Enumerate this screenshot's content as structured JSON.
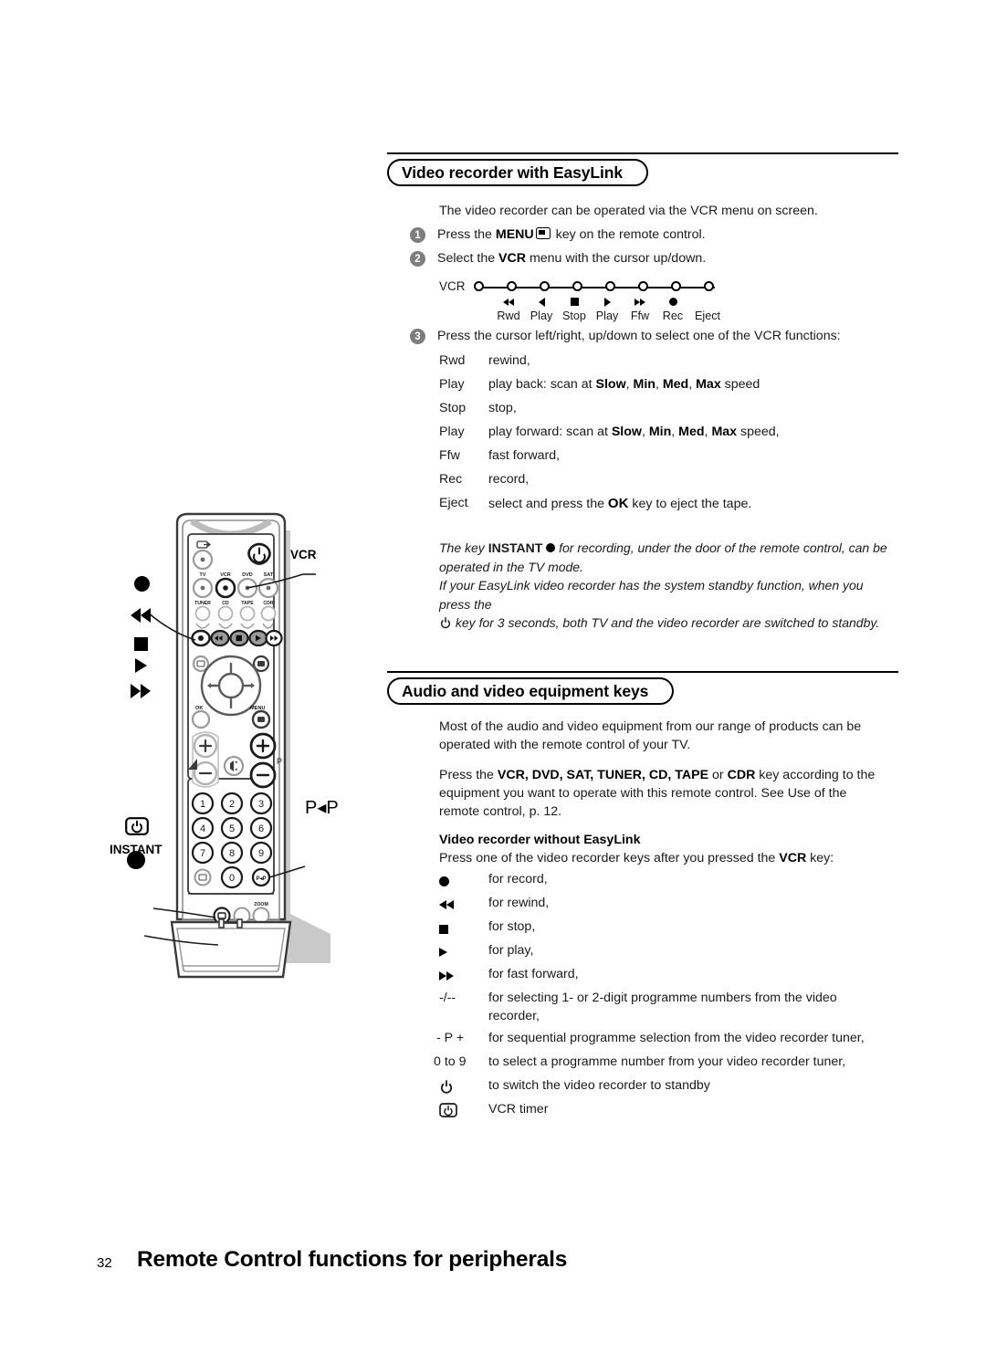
{
  "page": {
    "number": "32",
    "footer_title": "Remote Control functions for peripherals"
  },
  "section1": {
    "heading": "Video recorder with EasyLink",
    "intro": "The video recorder can be operated via the VCR menu on screen.",
    "steps": [
      {
        "num": "1",
        "before": "Press  the ",
        "bold": "MENU",
        "icon": "menu-key-icon",
        "after": " key on the remote control."
      },
      {
        "num": "2",
        "before": "Select the ",
        "bold": "VCR",
        "after": " menu with the cursor up/down."
      },
      {
        "num": "3",
        "before": "Press the cursor left/right, up/down to select one of the VCR functions:"
      }
    ],
    "vcr_diagram": {
      "label": "VCR",
      "nodes": [
        {
          "caption": "",
          "icon": ""
        },
        {
          "caption": "Rwd",
          "icon": "rewind-icon"
        },
        {
          "caption": "Play",
          "icon": "play-back-icon"
        },
        {
          "caption": "Stop",
          "icon": "stop-icon"
        },
        {
          "caption": "Play",
          "icon": "play-icon"
        },
        {
          "caption": "Ffw",
          "icon": "fast-forward-icon"
        },
        {
          "caption": "Rec",
          "icon": "record-icon"
        },
        {
          "caption": "Eject",
          "icon": ""
        }
      ]
    },
    "functions": [
      {
        "term": "Rwd",
        "desc_plain": "rewind,"
      },
      {
        "term": "Play",
        "desc_pre": "play back: scan at ",
        "b1": "Slow",
        "s1": ", ",
        "b2": "Min",
        "s2": ", ",
        "b3": "Med",
        "s3": ", ",
        "b4": "Max",
        "desc_post": " speed"
      },
      {
        "term": "Stop",
        "desc_plain": "stop,"
      },
      {
        "term": "Play",
        "desc_pre": "play forward: scan at ",
        "b1": "Slow",
        "s1": ", ",
        "b2": "Min",
        "s2": ", ",
        "b3": "Med",
        "s3": ", ",
        "b4": "Max",
        "desc_post": " speed,"
      },
      {
        "term": "Ffw",
        "desc_plain": "fast forward,"
      },
      {
        "term": "Rec",
        "desc_plain": "record,"
      },
      {
        "term": "Eject",
        "desc_pre": "select and press the ",
        "b1": "OK",
        "desc_post": " key to eject the tape."
      }
    ],
    "note": {
      "line1_a": "The key ",
      "line1_bold": "INSTANT",
      "line1_icon": "record-dot-icon",
      "line1_b": " for recording, under the door of the remote control, can be",
      "line2": "operated in the TV mode.",
      "line3": "If your EasyLink video recorder has the system standby function, when you press the",
      "line4_icon": "power-standby-icon",
      "line4": " key for 3 seconds, both TV and the video recorder are switched to standby."
    }
  },
  "section2": {
    "heading": "Audio and video equipment keys",
    "para1_line1": "Most of the audio and video equipment from our range of products can be",
    "para1_line2": "operated with the remote control of your TV.",
    "para2_pre": "Press the ",
    "para2_keys": "VCR, DVD, SAT, TUNER, CD, TAPE",
    "para2_mid": " or ",
    "para2_key2": "CDR",
    "para2_post": " key according to the",
    "para2_line2": "equipment you want to operate with this remote control. See Use of the",
    "para2_line3": "remote control, p. 12.",
    "subheading": "Video recorder without EasyLink",
    "sub_intro_pre": "Press one of the video recorder keys after you pressed the ",
    "sub_intro_bold": "VCR",
    "sub_intro_post": " key:",
    "keys": [
      {
        "icon": "record-icon",
        "term": "",
        "desc": "for record,"
      },
      {
        "icon": "rewind-icon",
        "term": "",
        "desc": "for rewind,"
      },
      {
        "icon": "stop-icon",
        "term": "",
        "desc": "for stop,"
      },
      {
        "icon": "play-icon",
        "term": "",
        "desc": "for play,"
      },
      {
        "icon": "fast-forward-icon",
        "term": "",
        "desc": "for fast forward,"
      },
      {
        "icon": "",
        "term": "-/--",
        "desc": "for selecting 1- or 2-digit programme numbers from the video",
        "desc2": "recorder,"
      },
      {
        "icon": "",
        "term": "- P +",
        "desc": "for sequential programme selection from the video recorder tuner,"
      },
      {
        "icon": "",
        "term": "0 to 9",
        "desc": "to select a programme number from your video recorder tuner,"
      },
      {
        "icon": "power-standby-icon",
        "term": "",
        "desc": "to switch the video recorder to standby"
      },
      {
        "icon": "vcr-timer-icon",
        "term": "",
        "desc": "VCR timer"
      }
    ]
  },
  "remote_figure": {
    "callouts": [
      {
        "id": "vcr",
        "label": "VCR"
      },
      {
        "id": "pip",
        "label": "P◂P"
      },
      {
        "id": "instant",
        "label": "INSTANT"
      }
    ],
    "key_labels": {
      "row1": [
        "TV",
        "VCR",
        "DVD",
        "SAT"
      ],
      "row2": [
        "TUNER",
        "CD",
        "TAPE",
        "CDR"
      ],
      "ok": "OK",
      "menu": "MENU",
      "zoom": "ZOOM",
      "instant": "INSTANT",
      "p": "P"
    },
    "numbers": [
      "1",
      "2",
      "3",
      "4",
      "5",
      "6",
      "7",
      "8",
      "9",
      "0"
    ]
  },
  "colors": {
    "text": "#1a1a1a",
    "rule": "#000000",
    "step_circle": "#7d7d7d",
    "remote_body": "#ffffff",
    "remote_outline": "#1a1a1a",
    "remote_shadow": "#b8b8b8",
    "key_gray": "#9a9a9a"
  }
}
